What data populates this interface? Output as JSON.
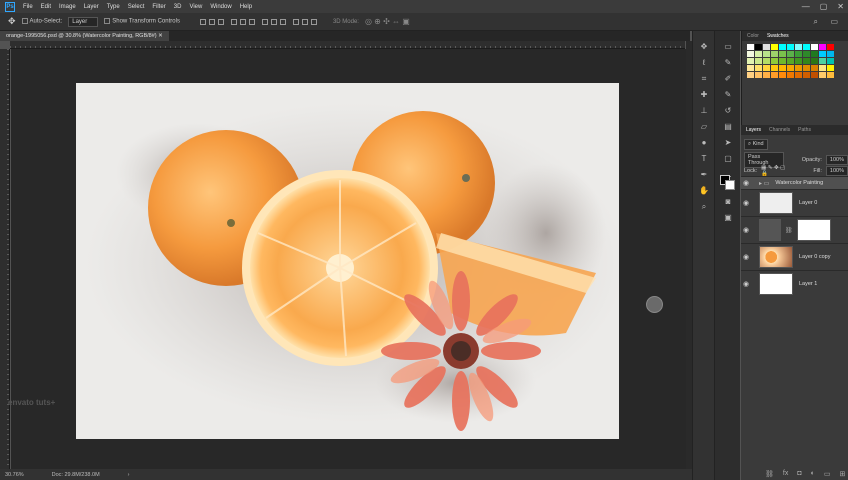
{
  "app": {
    "logo": "Ps"
  },
  "menu": [
    "File",
    "Edit",
    "Image",
    "Layer",
    "Type",
    "Select",
    "Filter",
    "3D",
    "View",
    "Window",
    "Help"
  ],
  "window_controls": {
    "minimize": "—",
    "maximize": "▢",
    "close": "✕"
  },
  "options": {
    "tool_icon": "move-tool-icon",
    "auto_select_label": "Auto-Select:",
    "auto_select_value": "Layer",
    "show_transform_label": "Show Transform Controls",
    "mode_label": "3D Mode:"
  },
  "document_tab": "orange-1995056.psd @ 30.8% (Watercolor Painting, RGB/8#)",
  "status": {
    "zoom": "30.76%",
    "doc": "Doc: 29.8M/238.0M"
  },
  "watermark": "envato tuts+",
  "panels": {
    "color_tab": "Color",
    "swatches_tab": "Swatches",
    "layers_tab": "Layers",
    "channels_tab": "Channels",
    "paths_tab": "Paths"
  },
  "layers": {
    "filter_kind": "Kind",
    "blend_mode": "Pass Through",
    "opacity_label": "Opacity:",
    "opacity_value": "100%",
    "lock_label": "Lock:",
    "fill_label": "Fill:",
    "fill_value": "100%",
    "items": [
      {
        "name": "Watercolor Painting",
        "type": "group"
      },
      {
        "name": "Layer 0"
      },
      {
        "name": ""
      },
      {
        "name": "Layer 0 copy"
      },
      {
        "name": "Layer 1"
      }
    ]
  },
  "swatch_colors": [
    [
      "#ffffff",
      "#000000",
      "#e0e0e0",
      "#ffff00",
      "#00ffff",
      "#00ffff",
      "#80ffff",
      "#00ffff",
      "#ffffff",
      "#ff00ff",
      "#ff0000"
    ],
    [
      "#f3f9e0",
      "#d7f0a8",
      "#b9e38a",
      "#9ed36b",
      "#7bc24c",
      "#5bb14a",
      "#3c9e35",
      "#2e8a2a",
      "#1f7a20",
      "#00ccff",
      "#00b7ee"
    ],
    [
      "#e2f2b1",
      "#cbe88b",
      "#b3dd66",
      "#8fcb3a",
      "#70b92b",
      "#5ba826",
      "#429720",
      "#34861b",
      "#2a7516",
      "#4ed1a0",
      "#00c3b0"
    ],
    [
      "#ffe99b",
      "#ffe06a",
      "#ffd53d",
      "#ffc80d",
      "#ffb800",
      "#f8a800",
      "#ec9a00",
      "#e08d00",
      "#d98000",
      "#ffe680",
      "#fff200"
    ],
    [
      "#ffd083",
      "#ffc165",
      "#ffb047",
      "#ff9d29",
      "#ff8a0b",
      "#f07800",
      "#e06a00",
      "#d05e00",
      "#c04f00",
      "#ffcb6a",
      "#ffbc3d"
    ]
  ]
}
